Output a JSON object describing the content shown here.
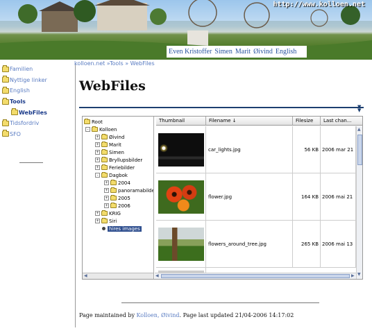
{
  "banner": {
    "url": "http://www.kolloen.net",
    "nav": [
      "Even Kristoffer",
      "Simen",
      "Marit",
      "Øivind",
      "English"
    ]
  },
  "sidebar": {
    "items": [
      {
        "label": "Familien",
        "bold": false,
        "indent": false
      },
      {
        "label": "Nyttige linker",
        "bold": false,
        "indent": false
      },
      {
        "label": "English",
        "bold": false,
        "indent": false
      },
      {
        "label": "Tools",
        "bold": true,
        "indent": false
      },
      {
        "label": "WebFiles",
        "bold": true,
        "indent": true
      },
      {
        "label": "Tidsfordriv",
        "bold": false,
        "indent": false
      },
      {
        "label": "SFO",
        "bold": false,
        "indent": false
      }
    ]
  },
  "breadcrumb": "kolloen.net »Tools » WebFiles",
  "title": "WebFiles",
  "tree": [
    {
      "label": "Root",
      "expander": "",
      "level": 0
    },
    {
      "label": "Kolloen",
      "expander": "-",
      "level": 1
    },
    {
      "label": "Øivind",
      "expander": "+",
      "level": 2
    },
    {
      "label": "Marit",
      "expander": "+",
      "level": 2
    },
    {
      "label": "Simen",
      "expander": "+",
      "level": 2
    },
    {
      "label": "Bryllupsbilder",
      "expander": "+",
      "level": 2
    },
    {
      "label": "Feriebilder",
      "expander": "+",
      "level": 2
    },
    {
      "label": "Dagbok",
      "expander": "-",
      "level": 2
    },
    {
      "label": "2004",
      "expander": "+",
      "level": 3
    },
    {
      "label": "panoramabilder",
      "expander": "+",
      "level": 3
    },
    {
      "label": "2005",
      "expander": "+",
      "level": 3
    },
    {
      "label": "2006",
      "expander": "+",
      "level": 3
    },
    {
      "label": "KRIG",
      "expander": "+",
      "level": 2
    },
    {
      "label": "Siri",
      "expander": "+",
      "level": 2
    },
    {
      "label": "hires images",
      "expander": "bullet",
      "level": 2,
      "selected": true
    }
  ],
  "grid": {
    "headers": {
      "thumbnail": "Thumbnail",
      "filename": "Filename ↓",
      "filesize": "Filesize",
      "lastchanged": "Last chan..."
    },
    "rows": [
      {
        "name": "car_lights.jpg",
        "size": "56 KB",
        "date": "2006 mar 21",
        "thumb": "car"
      },
      {
        "name": "flower.jpg",
        "size": "164 KB",
        "date": "2006 mai 21",
        "thumb": "flower"
      },
      {
        "name": "flowers_around_tree.jpg",
        "size": "265 KB",
        "date": "2006 mai 13",
        "thumb": "grass"
      },
      {
        "name": "",
        "size": "",
        "date": "",
        "thumb": "partial"
      }
    ]
  },
  "footer": {
    "prefix": "Page maintained by ",
    "link": "Kolloen, Øivind",
    "suffix": ". Page last updated 21/04-2006 14:17:02"
  }
}
